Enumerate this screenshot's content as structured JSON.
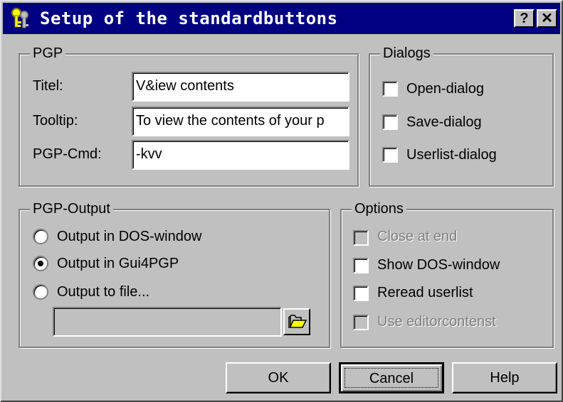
{
  "window": {
    "title": "Setup of the standardbuttons",
    "help_button": "?",
    "close_button": "✕"
  },
  "pgp": {
    "legend": "PGP",
    "titel_label": "Titel:",
    "titel_value": "V&iew contents",
    "tooltip_label": "Tooltip:",
    "tooltip_value": "To view the contents of your p",
    "cmd_label": "PGP-Cmd:",
    "cmd_value": "-kvv"
  },
  "dialogs": {
    "legend": "Dialogs",
    "items": [
      {
        "label": "Open-dialog",
        "checked": false
      },
      {
        "label": "Save-dialog",
        "checked": false
      },
      {
        "label": "Userlist-dialog",
        "checked": false
      }
    ]
  },
  "pgp_output": {
    "legend": "PGP-Output",
    "options": [
      {
        "label": "Output in DOS-window",
        "selected": false
      },
      {
        "label": "Output in Gui4PGP",
        "selected": true
      },
      {
        "label": "Output to file...",
        "selected": false
      }
    ],
    "file_value": ""
  },
  "options": {
    "legend": "Options",
    "items": [
      {
        "label": "Close at end",
        "checked": false,
        "enabled": false
      },
      {
        "label": "Show DOS-window",
        "checked": false,
        "enabled": true
      },
      {
        "label": "Reread userlist",
        "checked": false,
        "enabled": true
      },
      {
        "label": "Use editorcontenst",
        "checked": false,
        "enabled": false
      }
    ]
  },
  "buttons": {
    "ok": "OK",
    "cancel": "Cancel",
    "help": "Help"
  }
}
